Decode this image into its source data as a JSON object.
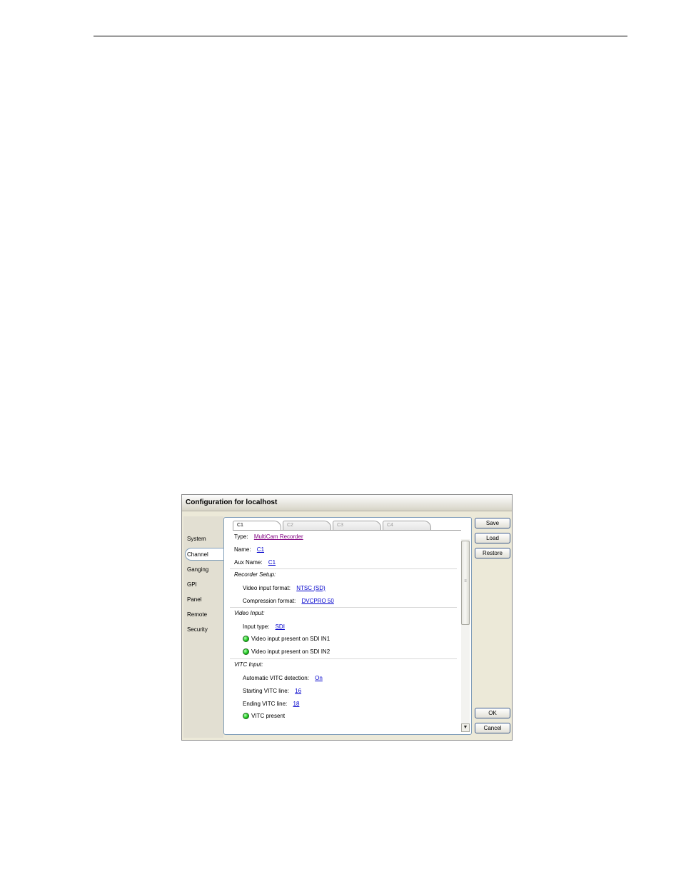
{
  "window": {
    "title": "Configuration for localhost"
  },
  "sidebar": {
    "items": [
      {
        "label": "System"
      },
      {
        "label": "Channel",
        "selected": true
      },
      {
        "label": "Ganging"
      },
      {
        "label": "GPI"
      },
      {
        "label": "Panel"
      },
      {
        "label": "Remote"
      },
      {
        "label": "Security"
      }
    ]
  },
  "tabs": [
    {
      "label": "C1",
      "active": true
    },
    {
      "label": "C2"
    },
    {
      "label": "C3"
    },
    {
      "label": "C4"
    }
  ],
  "channel": {
    "type": {
      "label": "Type:",
      "value": "MultiCam Recorder"
    },
    "name": {
      "label": "Name:",
      "value": "C1"
    },
    "aux_name": {
      "label": "Aux Name:",
      "value": "C1"
    },
    "recorder_setup": {
      "heading": "Recorder Setup:",
      "video_input_format": {
        "label": "Video input format:",
        "value": "NTSC (SD)"
      },
      "compression_format": {
        "label": "Compression format:",
        "value": "DVCPRO 50"
      }
    },
    "video_input": {
      "heading": "Video Input:",
      "input_type": {
        "label": "Input type:",
        "value": "SDI"
      },
      "status_in1": "Video input present on SDI IN1",
      "status_in2": "Video input present on SDI IN2"
    },
    "vitc_input": {
      "heading": "VITC Input:",
      "auto_detect": {
        "label": "Automatic VITC detection:",
        "value": "On"
      },
      "start_line": {
        "label": "Starting VITC line:",
        "value": "16"
      },
      "end_line": {
        "label": "Ending VITC line:",
        "value": "18"
      },
      "vitc_status": "VITC present"
    }
  },
  "buttons": {
    "save": "Save",
    "load": "Load",
    "restore": "Restore",
    "ok": "OK",
    "cancel": "Cancel"
  },
  "colors": {
    "link": "#0000cc",
    "led_on": "#22cc22"
  },
  "icons": {
    "status_led": "green-led-icon",
    "scroll_down": "chevron-down-icon"
  }
}
